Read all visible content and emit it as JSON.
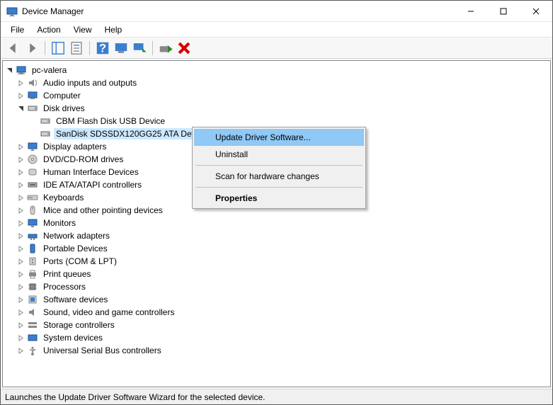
{
  "title": "Device Manager",
  "menubar": [
    "File",
    "Action",
    "View",
    "Help"
  ],
  "tree": {
    "root": "pc-valera",
    "categories": [
      {
        "label": "Audio inputs and outputs",
        "expanded": false
      },
      {
        "label": "Computer",
        "expanded": false
      },
      {
        "label": "Disk drives",
        "expanded": true,
        "children": [
          "CBM Flash Disk USB Device",
          "SanDisk SDSSDX120GG25 ATA Device"
        ]
      },
      {
        "label": "Display adapters",
        "expanded": false
      },
      {
        "label": "DVD/CD-ROM drives",
        "expanded": false
      },
      {
        "label": "Human Interface Devices",
        "expanded": false
      },
      {
        "label": "IDE ATA/ATAPI controllers",
        "expanded": false
      },
      {
        "label": "Keyboards",
        "expanded": false
      },
      {
        "label": "Mice and other pointing devices",
        "expanded": false
      },
      {
        "label": "Monitors",
        "expanded": false
      },
      {
        "label": "Network adapters",
        "expanded": false
      },
      {
        "label": "Portable Devices",
        "expanded": false
      },
      {
        "label": "Ports (COM & LPT)",
        "expanded": false
      },
      {
        "label": "Print queues",
        "expanded": false
      },
      {
        "label": "Processors",
        "expanded": false
      },
      {
        "label": "Software devices",
        "expanded": false
      },
      {
        "label": "Sound, video and game controllers",
        "expanded": false
      },
      {
        "label": "Storage controllers",
        "expanded": false
      },
      {
        "label": "System devices",
        "expanded": false
      },
      {
        "label": "Universal Serial Bus controllers",
        "expanded": false
      }
    ],
    "selected": "SanDisk SDSSDX120GG25 ATA Device"
  },
  "context_menu": {
    "items": [
      {
        "label": "Update Driver Software...",
        "highlighted": true
      },
      {
        "label": "Uninstall"
      },
      {
        "sep": true
      },
      {
        "label": "Scan for hardware changes"
      },
      {
        "sep": true
      },
      {
        "label": "Properties",
        "bold": true
      }
    ]
  },
  "statusbar": "Launches the Update Driver Software Wizard for the selected device."
}
